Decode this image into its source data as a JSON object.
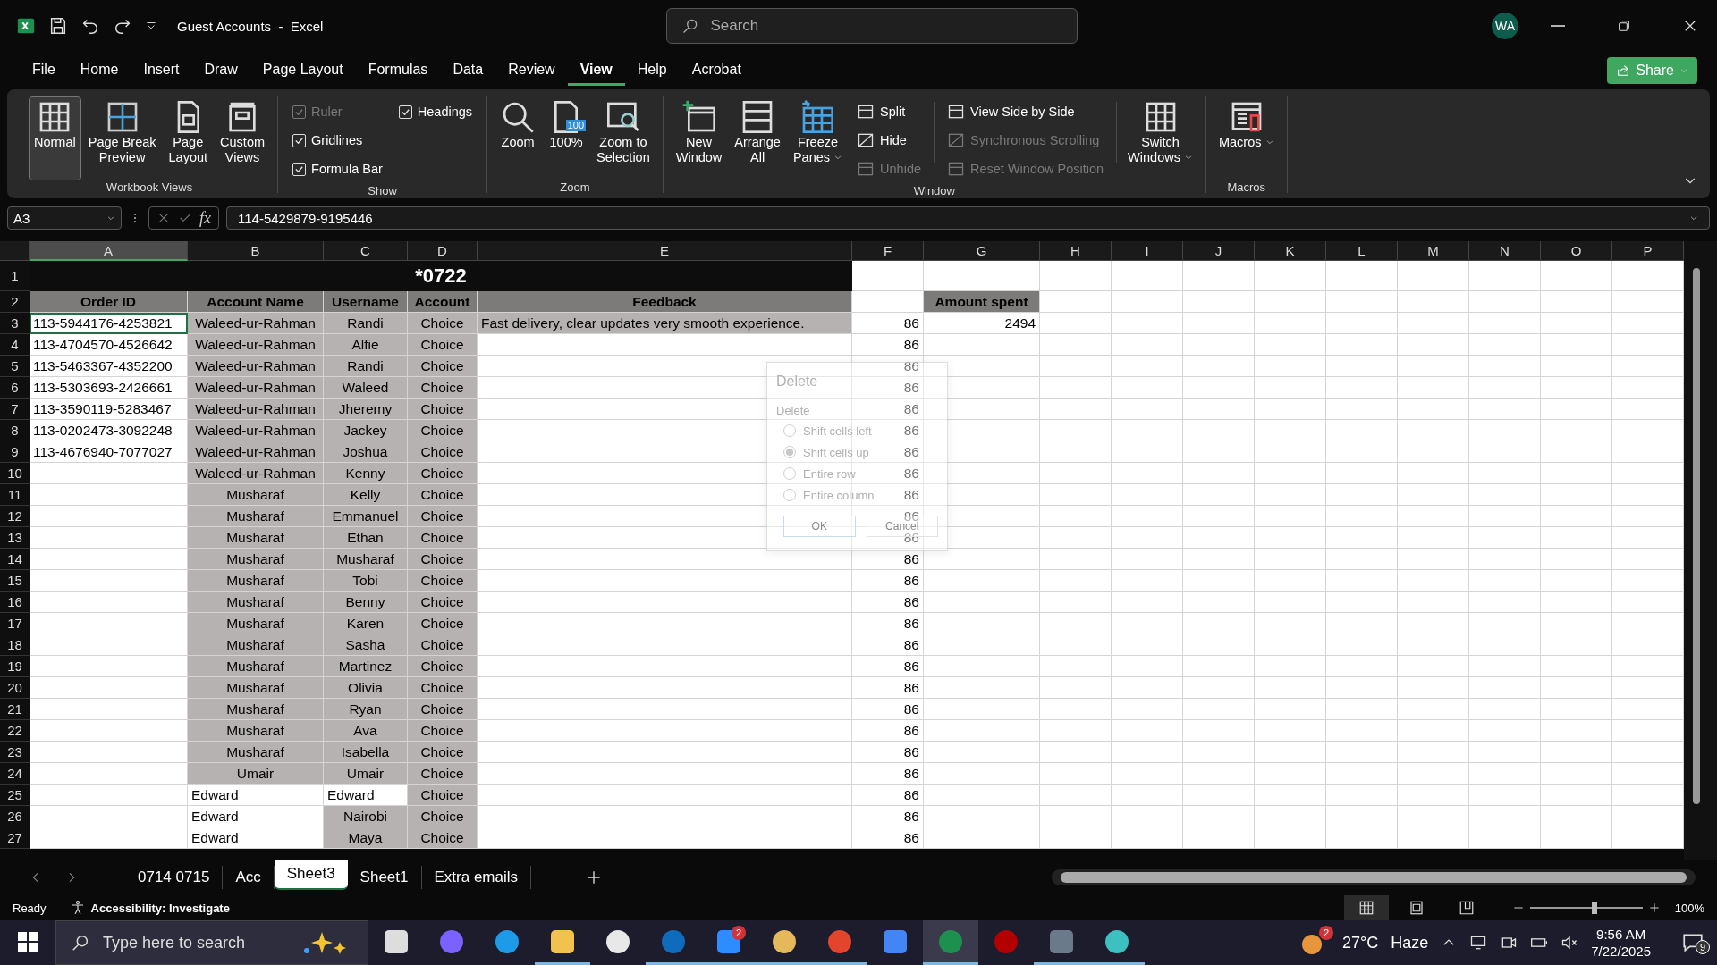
{
  "title_bar": {
    "title": "Guest Accounts  -  Excel",
    "search_placeholder": "Search",
    "avatar": "WA"
  },
  "menu_tabs": [
    {
      "label": "File",
      "selected": false
    },
    {
      "label": "Home",
      "selected": false
    },
    {
      "label": "Insert",
      "selected": false
    },
    {
      "label": "Draw",
      "selected": false
    },
    {
      "label": "Page Layout",
      "selected": false
    },
    {
      "label": "Formulas",
      "selected": false
    },
    {
      "label": "Data",
      "selected": false
    },
    {
      "label": "Review",
      "selected": false
    },
    {
      "label": "View",
      "selected": true
    },
    {
      "label": "Help",
      "selected": false
    },
    {
      "label": "Acrobat",
      "selected": false
    }
  ],
  "share_button": "Share",
  "ribbon_groups": [
    {
      "name": "Workbook Views",
      "items": [
        {
          "kind": "large",
          "lines": [
            "Normal"
          ],
          "selected": true
        },
        {
          "kind": "large",
          "lines": [
            "Page Break",
            "Preview"
          ],
          "selected": false
        },
        {
          "kind": "large",
          "lines": [
            "Page",
            "Layout"
          ],
          "selected": false
        },
        {
          "kind": "large",
          "lines": [
            "Custom",
            "Views"
          ],
          "selected": false
        }
      ]
    },
    {
      "name": "Show",
      "items": [
        {
          "kind": "stack",
          "items": [
            {
              "kind": "check",
              "label": "Ruler",
              "checked": true,
              "disabled": true
            },
            {
              "kind": "check",
              "label": "Gridlines",
              "checked": true,
              "disabled": false
            },
            {
              "kind": "check",
              "label": "Formula Bar",
              "checked": true,
              "disabled": false
            }
          ]
        },
        {
          "kind": "stack",
          "items": [
            {
              "kind": "check",
              "label": "Headings",
              "checked": true,
              "disabled": false
            }
          ]
        }
      ]
    },
    {
      "name": "Zoom",
      "items": [
        {
          "kind": "large",
          "lines": [
            "Zoom"
          ]
        },
        {
          "kind": "large",
          "lines": [
            "100%"
          ],
          "icon_text": "100"
        },
        {
          "kind": "large",
          "lines": [
            "Zoom to",
            "Selection"
          ]
        }
      ]
    },
    {
      "name": "Window",
      "items": [
        {
          "kind": "large",
          "lines": [
            "New",
            "Window"
          ]
        },
        {
          "kind": "large",
          "lines": [
            "Arrange",
            "All"
          ]
        },
        {
          "kind": "large",
          "lines": [
            "Freeze",
            "Panes"
          ],
          "dropdown": true
        },
        {
          "kind": "stack",
          "items": [
            {
              "kind": "small",
              "label": "Split",
              "disabled": false
            },
            {
              "kind": "small",
              "label": "Hide",
              "disabled": false
            },
            {
              "kind": "small",
              "label": "Unhide",
              "disabled": true
            }
          ]
        },
        {
          "kind": "separator"
        },
        {
          "kind": "stack",
          "items": [
            {
              "kind": "small",
              "label": "View Side by Side",
              "disabled": false
            },
            {
              "kind": "small",
              "label": "Synchronous Scrolling",
              "disabled": true
            },
            {
              "kind": "small",
              "label": "Reset Window Position",
              "disabled": true
            }
          ]
        },
        {
          "kind": "separator"
        },
        {
          "kind": "large",
          "lines": [
            "Switch",
            "Windows"
          ],
          "dropdown": true
        }
      ]
    },
    {
      "name": "Macros",
      "items": [
        {
          "kind": "large",
          "lines": [
            "Macros"
          ],
          "dropdown": true
        }
      ]
    }
  ],
  "formula_bar": {
    "name_box": "A3",
    "function_label": "fx",
    "value": "114-5429879-9195446"
  },
  "columns": [
    {
      "label": "A",
      "selected": true
    },
    {
      "label": "B",
      "selected": false
    },
    {
      "label": "C",
      "selected": false
    },
    {
      "label": "D",
      "selected": false
    },
    {
      "label": "E",
      "selected": false
    },
    {
      "label": "F",
      "selected": false
    },
    {
      "label": "G",
      "selected": false
    },
    {
      "label": "H",
      "selected": false
    },
    {
      "label": "I",
      "selected": false
    },
    {
      "label": "J",
      "selected": false
    },
    {
      "label": "K",
      "selected": false
    },
    {
      "label": "L",
      "selected": false
    },
    {
      "label": "M",
      "selected": false
    },
    {
      "label": "N",
      "selected": false
    },
    {
      "label": "O",
      "selected": false
    },
    {
      "label": "P",
      "selected": false
    }
  ],
  "rows": [
    {
      "n": "1",
      "kind": "title",
      "title": "*0722"
    },
    {
      "n": "2",
      "kind": "header",
      "active": false,
      "cells": [
        {
          "t": "Order ID",
          "shaded": true
        },
        {
          "t": "Account Name",
          "shaded": true
        },
        {
          "t": "Username",
          "shaded": true
        },
        {
          "t": "Account",
          "shaded": true
        },
        {
          "t": "Feedback",
          "shaded": true
        },
        {
          "shaded": false
        },
        {
          "t": "Amount spent",
          "shaded": true
        }
      ]
    },
    {
      "n": "3",
      "kind": "data",
      "active": true,
      "cells": [
        {
          "t": "113-5944176-4253821",
          "shaded": false
        },
        {
          "t": "Waleed-ur-Rahman",
          "shaded": true
        },
        {
          "t": "Randi",
          "shaded": true
        },
        {
          "t": "Choice",
          "shaded": true
        },
        {
          "t": "Fast delivery, clear updates very smooth experience.",
          "shaded": true
        },
        {
          "t": "86",
          "shaded": false
        },
        {
          "t": "2494",
          "shaded": false
        }
      ]
    },
    {
      "n": "4",
      "kind": "data",
      "active": false,
      "cells": [
        {
          "t": "113-4704570-4526642",
          "shaded": false
        },
        {
          "t": "Waleed-ur-Rahman",
          "shaded": true
        },
        {
          "t": "Alfie",
          "shaded": true
        },
        {
          "t": "Choice",
          "shaded": true
        },
        {
          "shaded": false
        },
        {
          "t": "86",
          "shaded": false
        },
        {
          "shaded": false
        }
      ]
    },
    {
      "n": "5",
      "kind": "data",
      "active": false,
      "cells": [
        {
          "t": "113-5463367-4352200",
          "shaded": false
        },
        {
          "t": "Waleed-ur-Rahman",
          "shaded": true
        },
        {
          "t": "Randi",
          "shaded": true
        },
        {
          "t": "Choice",
          "shaded": true
        },
        {
          "shaded": false
        },
        {
          "t": "86",
          "shaded": false
        },
        {
          "shaded": false
        }
      ]
    },
    {
      "n": "6",
      "kind": "data",
      "active": false,
      "cells": [
        {
          "t": "113-5303693-2426661",
          "shaded": false
        },
        {
          "t": "Waleed-ur-Rahman",
          "shaded": true
        },
        {
          "t": "Waleed",
          "shaded": true
        },
        {
          "t": "Choice",
          "shaded": true
        },
        {
          "shaded": false
        },
        {
          "t": "86",
          "shaded": false
        },
        {
          "shaded": false
        }
      ]
    },
    {
      "n": "7",
      "kind": "data",
      "active": false,
      "cells": [
        {
          "t": "113-3590119-5283467",
          "shaded": false
        },
        {
          "t": "Waleed-ur-Rahman",
          "shaded": true
        },
        {
          "t": "Jheremy",
          "shaded": true
        },
        {
          "t": "Choice",
          "shaded": true
        },
        {
          "shaded": false
        },
        {
          "t": "86",
          "shaded": false
        },
        {
          "shaded": false
        }
      ]
    },
    {
      "n": "8",
      "kind": "data",
      "active": false,
      "cells": [
        {
          "t": "113-0202473-3092248",
          "shaded": false
        },
        {
          "t": "Waleed-ur-Rahman",
          "shaded": true
        },
        {
          "t": "Jackey",
          "shaded": true
        },
        {
          "t": "Choice",
          "shaded": true
        },
        {
          "shaded": false
        },
        {
          "t": "86",
          "shaded": false
        },
        {
          "shaded": false
        }
      ]
    },
    {
      "n": "9",
      "kind": "data",
      "active": false,
      "cells": [
        {
          "t": "113-4676940-7077027",
          "shaded": false
        },
        {
          "t": "Waleed-ur-Rahman",
          "shaded": true
        },
        {
          "t": "Joshua",
          "shaded": true
        },
        {
          "t": "Choice",
          "shaded": true
        },
        {
          "shaded": false
        },
        {
          "t": "86",
          "shaded": false
        },
        {
          "shaded": false
        }
      ]
    },
    {
      "n": "10",
      "kind": "data",
      "active": false,
      "cells": [
        {
          "shaded": false
        },
        {
          "t": "Waleed-ur-Rahman",
          "shaded": true
        },
        {
          "t": "Kenny",
          "shaded": true
        },
        {
          "t": "Choice",
          "shaded": true
        },
        {
          "shaded": false
        },
        {
          "t": "86",
          "shaded": false
        },
        {
          "shaded": false
        }
      ]
    },
    {
      "n": "11",
      "kind": "data",
      "active": false,
      "cells": [
        {
          "shaded": false
        },
        {
          "t": "Musharaf",
          "shaded": true
        },
        {
          "t": "Kelly",
          "shaded": true
        },
        {
          "t": "Choice",
          "shaded": true
        },
        {
          "shaded": false
        },
        {
          "t": "86",
          "shaded": false
        },
        {
          "shaded": false
        }
      ]
    },
    {
      "n": "12",
      "kind": "data",
      "active": false,
      "cells": [
        {
          "shaded": false
        },
        {
          "t": "Musharaf",
          "shaded": true
        },
        {
          "t": "Emmanuel",
          "shaded": true
        },
        {
          "t": "Choice",
          "shaded": true
        },
        {
          "shaded": false
        },
        {
          "t": "86",
          "shaded": false
        },
        {
          "shaded": false
        }
      ]
    },
    {
      "n": "13",
      "kind": "data",
      "active": false,
      "cells": [
        {
          "shaded": false
        },
        {
          "t": "Musharaf",
          "shaded": true
        },
        {
          "t": "Ethan",
          "shaded": true
        },
        {
          "t": "Choice",
          "shaded": true
        },
        {
          "shaded": false
        },
        {
          "t": "86",
          "shaded": false
        },
        {
          "shaded": false
        }
      ]
    },
    {
      "n": "14",
      "kind": "data",
      "active": false,
      "cells": [
        {
          "shaded": false
        },
        {
          "t": "Musharaf",
          "shaded": true
        },
        {
          "t": "Musharaf",
          "shaded": true
        },
        {
          "t": "Choice",
          "shaded": true
        },
        {
          "shaded": false
        },
        {
          "t": "86",
          "shaded": false
        },
        {
          "shaded": false
        }
      ]
    },
    {
      "n": "15",
      "kind": "data",
      "active": false,
      "cells": [
        {
          "shaded": false
        },
        {
          "t": "Musharaf",
          "shaded": true
        },
        {
          "t": "Tobi",
          "shaded": true
        },
        {
          "t": "Choice",
          "shaded": true
        },
        {
          "shaded": false
        },
        {
          "t": "86",
          "shaded": false
        },
        {
          "shaded": false
        }
      ]
    },
    {
      "n": "16",
      "kind": "data",
      "active": false,
      "cells": [
        {
          "shaded": false
        },
        {
          "t": "Musharaf",
          "shaded": true
        },
        {
          "t": "Benny",
          "shaded": true
        },
        {
          "t": "Choice",
          "shaded": true
        },
        {
          "shaded": false
        },
        {
          "t": "86",
          "shaded": false
        },
        {
          "shaded": false
        }
      ]
    },
    {
      "n": "17",
      "kind": "data",
      "active": false,
      "cells": [
        {
          "shaded": false
        },
        {
          "t": "Musharaf",
          "shaded": true
        },
        {
          "t": "Karen",
          "shaded": true
        },
        {
          "t": "Choice",
          "shaded": true
        },
        {
          "shaded": false
        },
        {
          "t": "86",
          "shaded": false
        },
        {
          "shaded": false
        }
      ]
    },
    {
      "n": "18",
      "kind": "data",
      "active": false,
      "cells": [
        {
          "shaded": false
        },
        {
          "t": "Musharaf",
          "shaded": true
        },
        {
          "t": "Sasha",
          "shaded": true
        },
        {
          "t": "Choice",
          "shaded": true
        },
        {
          "shaded": false
        },
        {
          "t": "86",
          "shaded": false
        },
        {
          "shaded": false
        }
      ]
    },
    {
      "n": "19",
      "kind": "data",
      "active": false,
      "cells": [
        {
          "shaded": false
        },
        {
          "t": "Musharaf",
          "shaded": true
        },
        {
          "t": "Martinez",
          "shaded": true
        },
        {
          "t": "Choice",
          "shaded": true
        },
        {
          "shaded": false
        },
        {
          "t": "86",
          "shaded": false
        },
        {
          "shaded": false
        }
      ]
    },
    {
      "n": "20",
      "kind": "data",
      "active": false,
      "cells": [
        {
          "shaded": false
        },
        {
          "t": "Musharaf",
          "shaded": true
        },
        {
          "t": "Olivia",
          "shaded": true
        },
        {
          "t": "Choice",
          "shaded": true
        },
        {
          "shaded": false
        },
        {
          "t": "86",
          "shaded": false
        },
        {
          "shaded": false
        }
      ]
    },
    {
      "n": "21",
      "kind": "data",
      "active": false,
      "cells": [
        {
          "shaded": false
        },
        {
          "t": "Musharaf",
          "shaded": true
        },
        {
          "t": "Ryan",
          "shaded": true
        },
        {
          "t": "Choice",
          "shaded": true
        },
        {
          "shaded": false
        },
        {
          "t": "86",
          "shaded": false
        },
        {
          "shaded": false
        }
      ]
    },
    {
      "n": "22",
      "kind": "data",
      "active": false,
      "cells": [
        {
          "shaded": false
        },
        {
          "t": "Musharaf",
          "shaded": true
        },
        {
          "t": "Ava",
          "shaded": true
        },
        {
          "t": "Choice",
          "shaded": true
        },
        {
          "shaded": false
        },
        {
          "t": "86",
          "shaded": false
        },
        {
          "shaded": false
        }
      ]
    },
    {
      "n": "23",
      "kind": "data",
      "active": false,
      "cells": [
        {
          "shaded": false
        },
        {
          "t": "Musharaf",
          "shaded": true
        },
        {
          "t": "Isabella",
          "shaded": true
        },
        {
          "t": "Choice",
          "shaded": true
        },
        {
          "shaded": false
        },
        {
          "t": "86",
          "shaded": false
        },
        {
          "shaded": false
        }
      ]
    },
    {
      "n": "24",
      "kind": "data",
      "active": false,
      "cells": [
        {
          "shaded": false
        },
        {
          "t": "Umair",
          "shaded": true
        },
        {
          "t": "Umair",
          "shaded": true
        },
        {
          "t": "Choice",
          "shaded": true
        },
        {
          "shaded": false
        },
        {
          "t": "86",
          "shaded": false
        },
        {
          "shaded": false
        }
      ]
    },
    {
      "n": "25",
      "kind": "data",
      "active": false,
      "cells": [
        {
          "shaded": false
        },
        {
          "t": "Edward",
          "shaded": false
        },
        {
          "t": "Edward",
          "shaded": false
        },
        {
          "t": "Choice",
          "shaded": true
        },
        {
          "shaded": false
        },
        {
          "t": "86",
          "shaded": false
        },
        {
          "shaded": false
        }
      ]
    },
    {
      "n": "26",
      "kind": "data",
      "active": false,
      "cells": [
        {
          "shaded": false
        },
        {
          "t": "Edward",
          "shaded": false
        },
        {
          "t": "Nairobi",
          "shaded": true
        },
        {
          "t": "Choice",
          "shaded": true
        },
        {
          "shaded": false
        },
        {
          "t": "86",
          "shaded": false
        },
        {
          "shaded": false
        }
      ]
    },
    {
      "n": "27",
      "kind": "data",
      "active": false,
      "cells": [
        {
          "shaded": false
        },
        {
          "t": "Edward",
          "shaded": false
        },
        {
          "t": "Maya",
          "shaded": true
        },
        {
          "t": "Choice",
          "shaded": true
        },
        {
          "shaded": false
        },
        {
          "t": "86",
          "shaded": false
        },
        {
          "shaded": false
        }
      ]
    }
  ],
  "delete_dialog": {
    "title": "Delete",
    "group": "Delete",
    "options": [
      {
        "label": "Shift cells left",
        "selected": false
      },
      {
        "label": "Shift cells up",
        "selected": true
      },
      {
        "label": "Entire row",
        "selected": false
      },
      {
        "label": "Entire column",
        "selected": false
      }
    ],
    "buttons": [
      "OK",
      "Cancel"
    ]
  },
  "sheet_tabs": [
    {
      "label": "0714 0715",
      "selected": false
    },
    {
      "label": "Acc",
      "selected": false
    },
    {
      "label": "Sheet3",
      "selected": true
    },
    {
      "label": "Sheet1",
      "selected": false
    },
    {
      "label": "Extra emails",
      "selected": false
    }
  ],
  "status_bar": {
    "status": "Ready",
    "accessibility": "Accessibility: Investigate",
    "zoom_slider": {
      "level": 0.57
    },
    "zoom": "100%"
  },
  "taskbar": {
    "search_placeholder": "Type here to search",
    "apps": [
      {
        "running": false,
        "active": false
      },
      {
        "running": false,
        "active": false
      },
      {
        "running": false,
        "active": false
      },
      {
        "running": true,
        "active": false
      },
      {
        "running": false,
        "active": false
      },
      {
        "running": true,
        "active": false
      },
      {
        "running": true,
        "active": false,
        "badge": "2"
      },
      {
        "running": true,
        "active": false
      },
      {
        "running": true,
        "active": false
      },
      {
        "running": false,
        "active": false
      },
      {
        "running": true,
        "active": true
      },
      {
        "running": false,
        "active": false
      },
      {
        "running": true,
        "active": false
      },
      {
        "running": true,
        "active": false
      }
    ],
    "weather_badge": "2",
    "temperature": "27°C",
    "weather": "Haze",
    "time": "9:56 AM",
    "date": "7/22/2025",
    "notifications": "9"
  }
}
